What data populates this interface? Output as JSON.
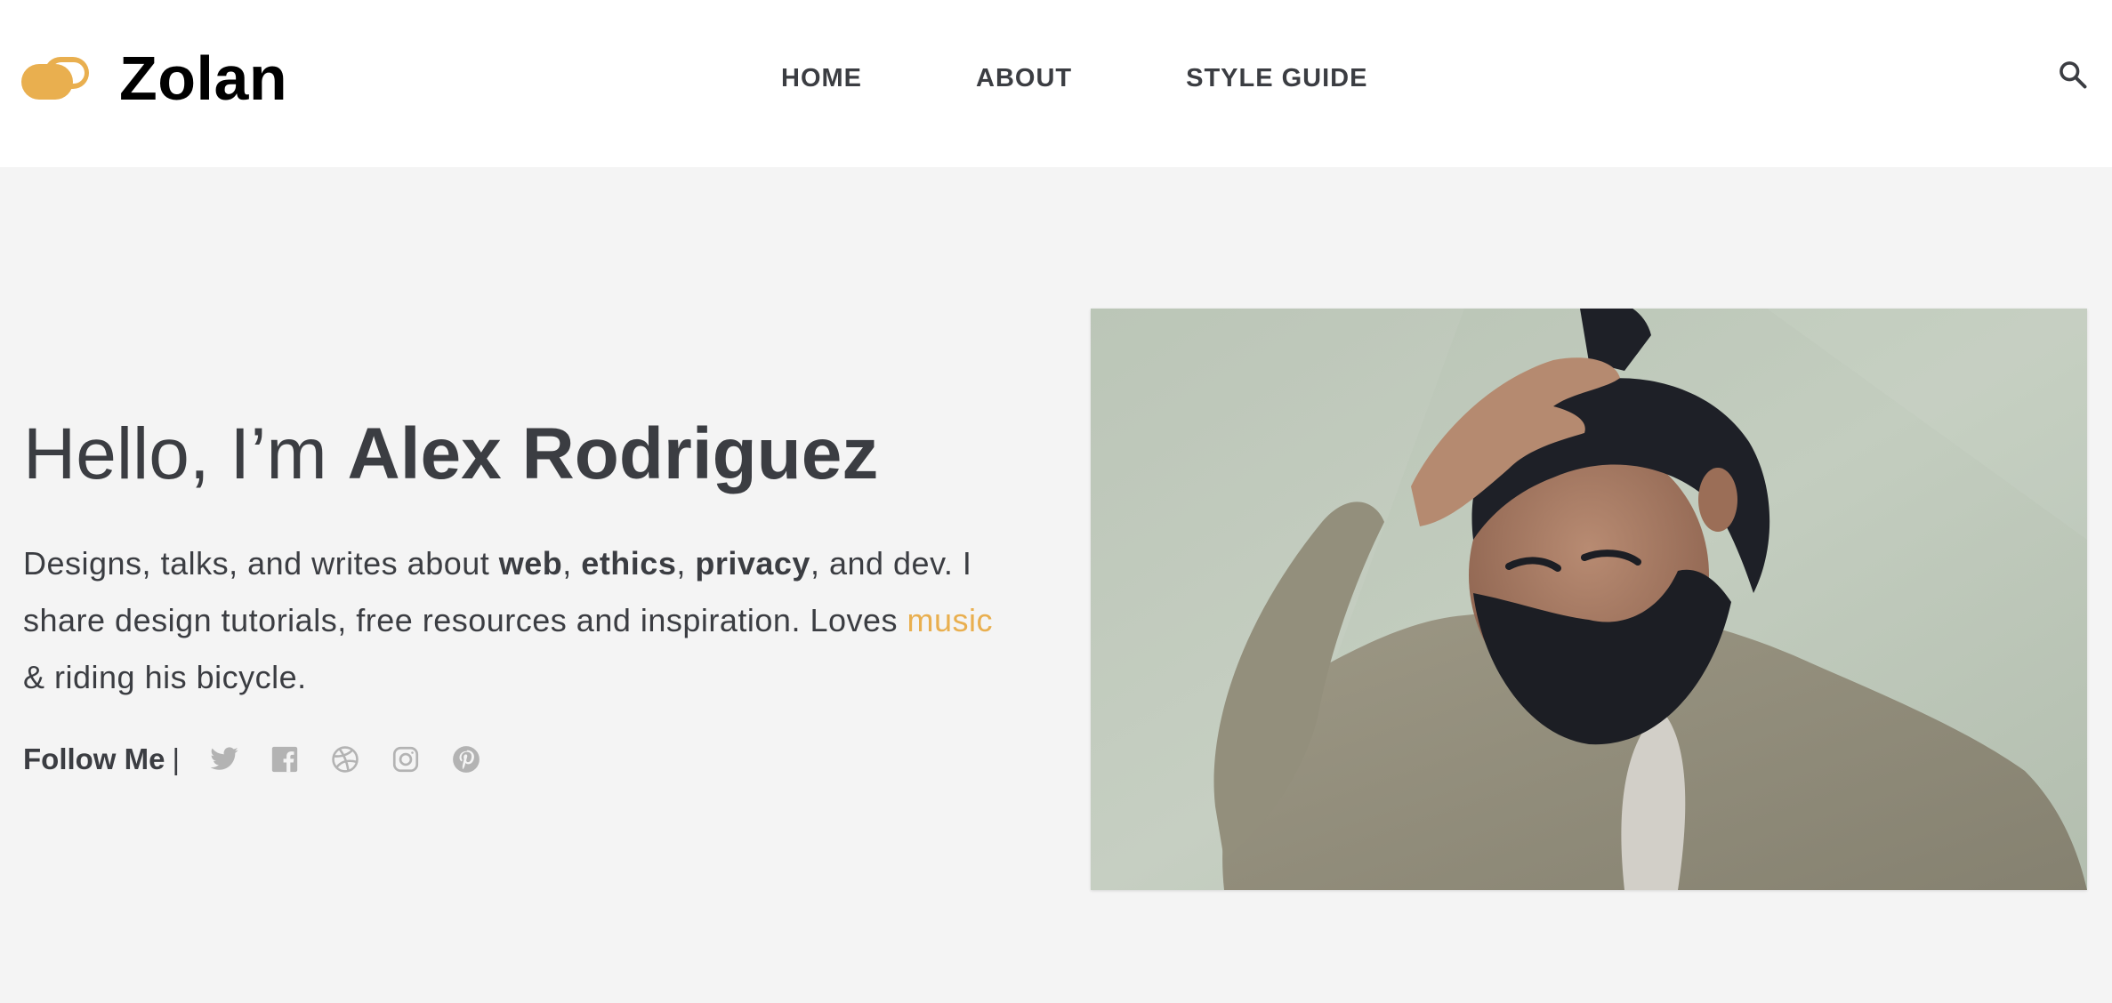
{
  "brand": {
    "name": "Zolan",
    "logo_color": "#e9af4f"
  },
  "nav": {
    "items": [
      {
        "label": "HOME"
      },
      {
        "label": "ABOUT"
      },
      {
        "label": "STYLE GUIDE"
      }
    ],
    "search_icon": "search-icon"
  },
  "hero": {
    "greeting_prefix": "Hello, I’m ",
    "name": "Alex Rodriguez",
    "bio": {
      "part1": "Designs, talks, and writes about ",
      "web": "web",
      "comma1": ", ",
      "ethics": "ethics",
      "comma2": ", ",
      "privacy": "privacy",
      "part2": ", and dev. I share design tutorials, free resources and inspiration. Loves ",
      "music_link": "music",
      "part3": " & riding his bicycle."
    },
    "follow_label": "Follow Me",
    "follow_separator": "|",
    "social_icons": [
      "twitter-icon",
      "facebook-icon",
      "dribbble-icon",
      "instagram-icon",
      "pinterest-icon"
    ],
    "social_icon_color": "#b3b3b3",
    "accent_color": "#e9af4f",
    "photo_subject": "bearded man with top-knot, hand on head, olive bomber jacket"
  }
}
